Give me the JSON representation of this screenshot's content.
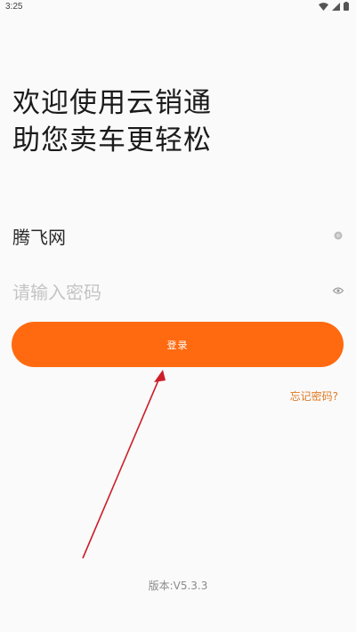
{
  "status_bar": {
    "time": "3:25",
    "icons": [
      "wifi-icon",
      "signal-icon",
      "battery-icon"
    ]
  },
  "welcome": {
    "line1": "欢迎使用云销通",
    "line2": "助您卖车更轻松"
  },
  "form": {
    "username_value": "腾飞网",
    "password_placeholder": "请输入密码"
  },
  "login_button": {
    "label": "登录",
    "color": "#ff6a10"
  },
  "forgot_password": {
    "label": "忘记密码?"
  },
  "version": {
    "text": "版本:V5.3.3"
  },
  "annotation": {
    "arrow_color": "#cc1f2a"
  }
}
